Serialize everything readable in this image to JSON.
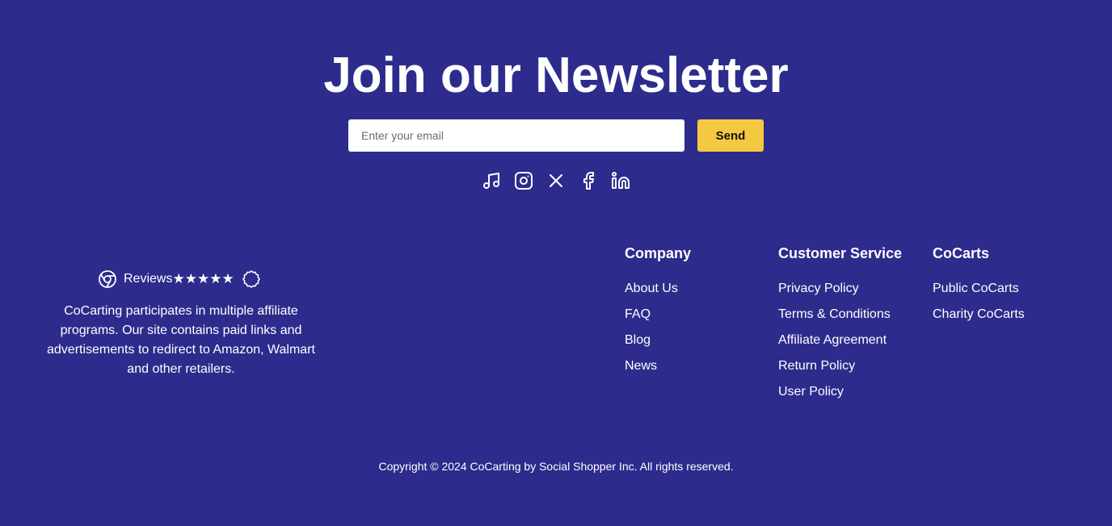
{
  "newsletter": {
    "title": "Join our Newsletter",
    "email_placeholder": "Enter your email",
    "email_value": "",
    "send_label": "Send"
  },
  "social": [
    "music-note-icon",
    "instagram-icon",
    "x-icon",
    "facebook-icon",
    "linkedin-icon"
  ],
  "reviews": {
    "icon": "chrome-icon",
    "label": "Reviews",
    "stars": "★★★★★",
    "badge_icon": "badge-icon"
  },
  "affiliate_text": "CoCarting participates in multiple affiliate programs. Our site contains paid links and advertisements to redirect to Amazon, Walmart and other retailers.",
  "columns": [
    {
      "heading": "Company",
      "links": [
        "About Us",
        "FAQ",
        "Blog",
        "News"
      ]
    },
    {
      "heading": "Customer Service",
      "links": [
        "Privacy Policy",
        "Terms & Conditions",
        "Affiliate Agreement",
        "Return Policy",
        "User Policy"
      ]
    },
    {
      "heading": "CoCarts",
      "links": [
        "Public CoCarts",
        "Charity CoCarts"
      ]
    }
  ],
  "copyright": "Copyright © 2024 CoCarting by Social Shopper Inc. All rights reserved.",
  "colors": {
    "background": "#2d2b8c",
    "accent": "#f5c842",
    "text": "#ffffff"
  }
}
